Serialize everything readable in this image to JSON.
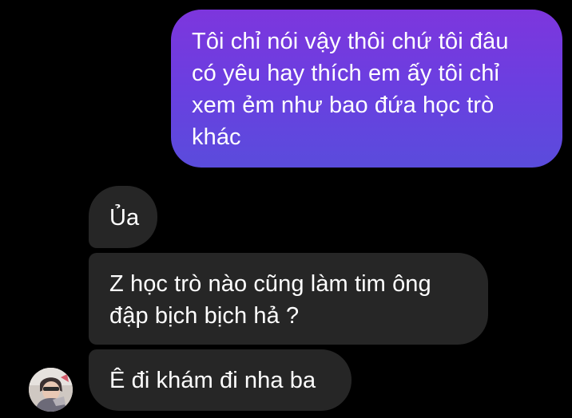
{
  "conversation": {
    "messages": [
      {
        "direction": "outgoing",
        "text": "Tôi chỉ nói vậy thôi chứ tôi đâu\ncó yêu hay thích em ấy tôi chỉ\nxem ẻm như bao đứa học trò\nkhác"
      },
      {
        "direction": "incoming",
        "text": "Ủa"
      },
      {
        "direction": "incoming",
        "text": "Z học trò nào cũng làm tim ông\nđập bịch bịch hả ?"
      },
      {
        "direction": "incoming",
        "text": "Ê đi khám đi nha ba"
      }
    ],
    "contact_avatar": {
      "icon": "profile-photo-avatar"
    }
  },
  "colors": {
    "background": "#000000",
    "outgoing_bubble_gradient": [
      "#7d36dd",
      "#5a4cdc"
    ],
    "incoming_bubble": "#262626",
    "text": "#ffffff"
  }
}
